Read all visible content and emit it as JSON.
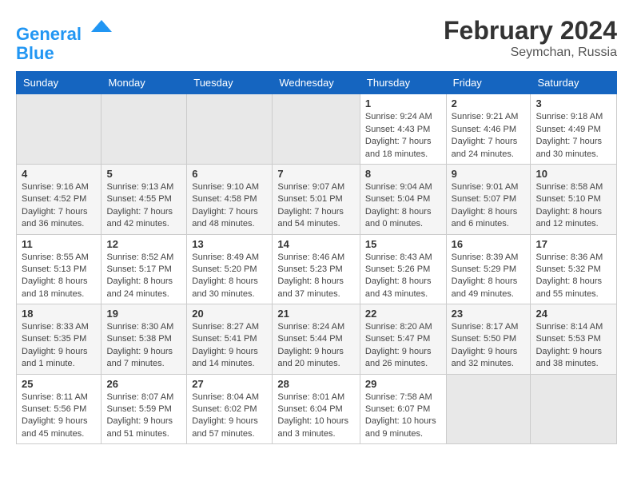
{
  "logo": {
    "line1": "General",
    "line2": "Blue"
  },
  "title": "February 2024",
  "subtitle": "Seymchan, Russia",
  "days_header": [
    "Sunday",
    "Monday",
    "Tuesday",
    "Wednesday",
    "Thursday",
    "Friday",
    "Saturday"
  ],
  "weeks": [
    [
      {
        "day": "",
        "info": ""
      },
      {
        "day": "",
        "info": ""
      },
      {
        "day": "",
        "info": ""
      },
      {
        "day": "",
        "info": ""
      },
      {
        "day": "1",
        "info": "Sunrise: 9:24 AM\nSunset: 4:43 PM\nDaylight: 7 hours\nand 18 minutes."
      },
      {
        "day": "2",
        "info": "Sunrise: 9:21 AM\nSunset: 4:46 PM\nDaylight: 7 hours\nand 24 minutes."
      },
      {
        "day": "3",
        "info": "Sunrise: 9:18 AM\nSunset: 4:49 PM\nDaylight: 7 hours\nand 30 minutes."
      }
    ],
    [
      {
        "day": "4",
        "info": "Sunrise: 9:16 AM\nSunset: 4:52 PM\nDaylight: 7 hours\nand 36 minutes."
      },
      {
        "day": "5",
        "info": "Sunrise: 9:13 AM\nSunset: 4:55 PM\nDaylight: 7 hours\nand 42 minutes."
      },
      {
        "day": "6",
        "info": "Sunrise: 9:10 AM\nSunset: 4:58 PM\nDaylight: 7 hours\nand 48 minutes."
      },
      {
        "day": "7",
        "info": "Sunrise: 9:07 AM\nSunset: 5:01 PM\nDaylight: 7 hours\nand 54 minutes."
      },
      {
        "day": "8",
        "info": "Sunrise: 9:04 AM\nSunset: 5:04 PM\nDaylight: 8 hours\nand 0 minutes."
      },
      {
        "day": "9",
        "info": "Sunrise: 9:01 AM\nSunset: 5:07 PM\nDaylight: 8 hours\nand 6 minutes."
      },
      {
        "day": "10",
        "info": "Sunrise: 8:58 AM\nSunset: 5:10 PM\nDaylight: 8 hours\nand 12 minutes."
      }
    ],
    [
      {
        "day": "11",
        "info": "Sunrise: 8:55 AM\nSunset: 5:13 PM\nDaylight: 8 hours\nand 18 minutes."
      },
      {
        "day": "12",
        "info": "Sunrise: 8:52 AM\nSunset: 5:17 PM\nDaylight: 8 hours\nand 24 minutes."
      },
      {
        "day": "13",
        "info": "Sunrise: 8:49 AM\nSunset: 5:20 PM\nDaylight: 8 hours\nand 30 minutes."
      },
      {
        "day": "14",
        "info": "Sunrise: 8:46 AM\nSunset: 5:23 PM\nDaylight: 8 hours\nand 37 minutes."
      },
      {
        "day": "15",
        "info": "Sunrise: 8:43 AM\nSunset: 5:26 PM\nDaylight: 8 hours\nand 43 minutes."
      },
      {
        "day": "16",
        "info": "Sunrise: 8:39 AM\nSunset: 5:29 PM\nDaylight: 8 hours\nand 49 minutes."
      },
      {
        "day": "17",
        "info": "Sunrise: 8:36 AM\nSunset: 5:32 PM\nDaylight: 8 hours\nand 55 minutes."
      }
    ],
    [
      {
        "day": "18",
        "info": "Sunrise: 8:33 AM\nSunset: 5:35 PM\nDaylight: 9 hours\nand 1 minute."
      },
      {
        "day": "19",
        "info": "Sunrise: 8:30 AM\nSunset: 5:38 PM\nDaylight: 9 hours\nand 7 minutes."
      },
      {
        "day": "20",
        "info": "Sunrise: 8:27 AM\nSunset: 5:41 PM\nDaylight: 9 hours\nand 14 minutes."
      },
      {
        "day": "21",
        "info": "Sunrise: 8:24 AM\nSunset: 5:44 PM\nDaylight: 9 hours\nand 20 minutes."
      },
      {
        "day": "22",
        "info": "Sunrise: 8:20 AM\nSunset: 5:47 PM\nDaylight: 9 hours\nand 26 minutes."
      },
      {
        "day": "23",
        "info": "Sunrise: 8:17 AM\nSunset: 5:50 PM\nDaylight: 9 hours\nand 32 minutes."
      },
      {
        "day": "24",
        "info": "Sunrise: 8:14 AM\nSunset: 5:53 PM\nDaylight: 9 hours\nand 38 minutes."
      }
    ],
    [
      {
        "day": "25",
        "info": "Sunrise: 8:11 AM\nSunset: 5:56 PM\nDaylight: 9 hours\nand 45 minutes."
      },
      {
        "day": "26",
        "info": "Sunrise: 8:07 AM\nSunset: 5:59 PM\nDaylight: 9 hours\nand 51 minutes."
      },
      {
        "day": "27",
        "info": "Sunrise: 8:04 AM\nSunset: 6:02 PM\nDaylight: 9 hours\nand 57 minutes."
      },
      {
        "day": "28",
        "info": "Sunrise: 8:01 AM\nSunset: 6:04 PM\nDaylight: 10 hours\nand 3 minutes."
      },
      {
        "day": "29",
        "info": "Sunrise: 7:58 AM\nSunset: 6:07 PM\nDaylight: 10 hours\nand 9 minutes."
      },
      {
        "day": "",
        "info": ""
      },
      {
        "day": "",
        "info": ""
      }
    ]
  ]
}
